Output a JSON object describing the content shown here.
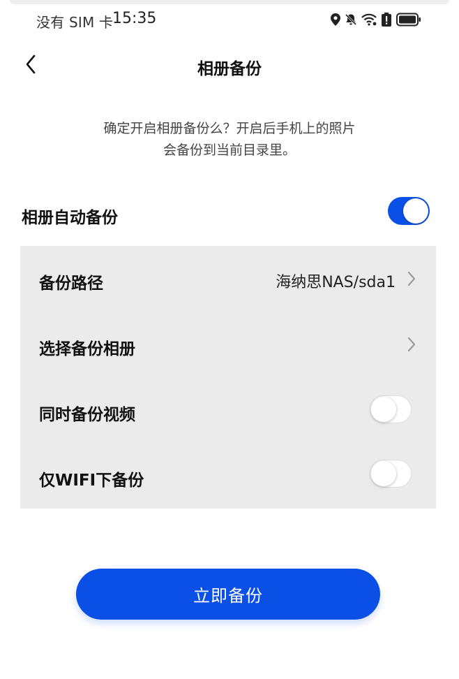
{
  "status_bar": {
    "carrier": "没有 SIM 卡",
    "time": "15:35",
    "icons": [
      "location-icon",
      "bell-off-icon",
      "wifi-icon",
      "battery-alert-icon",
      "battery-icon"
    ]
  },
  "header": {
    "back_icon": "chevron-left-icon",
    "title": "相册备份"
  },
  "description": {
    "line1": "确定开启相册备份么？开启后手机上的照片",
    "line2": "会备份到当前目录里。"
  },
  "auto_backup": {
    "label": "相册自动备份",
    "enabled": true
  },
  "settings": {
    "backup_path": {
      "label": "备份路径",
      "value": "海纳思NAS/sda1"
    },
    "select_albums": {
      "label": "选择备份相册"
    },
    "backup_videos": {
      "label": "同时备份视频",
      "enabled": false
    },
    "wifi_only": {
      "label": "仅WIFI下备份",
      "enabled": false
    }
  },
  "actions": {
    "backup_now": "立即备份"
  },
  "colors": {
    "accent": "#0a50e6",
    "panel": "#ebebeb",
    "background": "#ffffff"
  }
}
